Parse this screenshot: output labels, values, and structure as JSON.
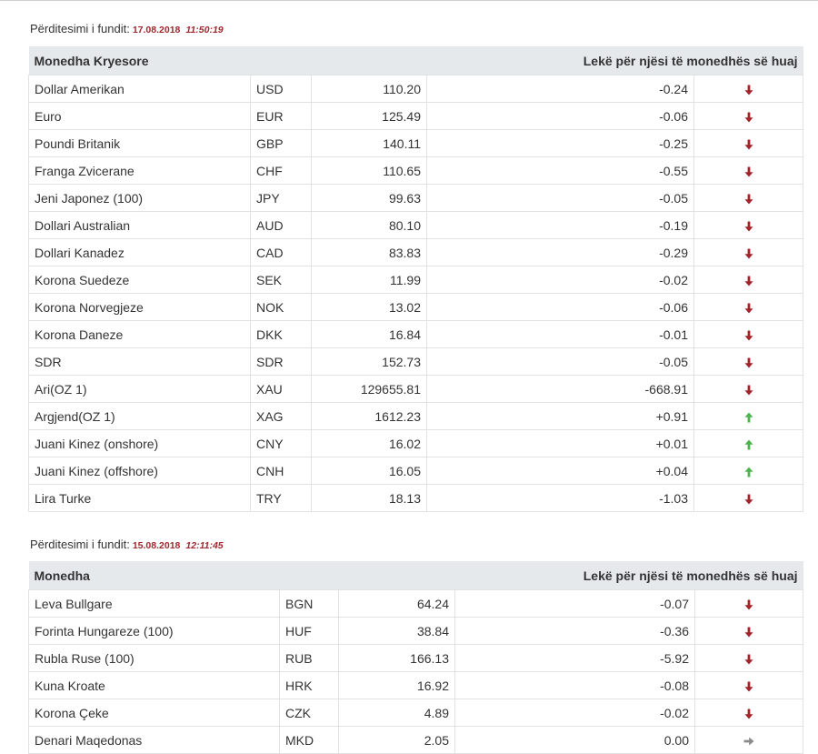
{
  "section1": {
    "update_label": "Përditesimi i fundit:",
    "date": "17.08.2018",
    "time": "11:50:19",
    "header_name": "Monedha Kryesore",
    "header_unit": "Lekë për njësi të monedhës së huaj",
    "rows": [
      {
        "name": "Dollar Amerikan",
        "code": "USD",
        "rate": "110.20",
        "change": "-0.24",
        "trend": "down"
      },
      {
        "name": "Euro",
        "code": "EUR",
        "rate": "125.49",
        "change": "-0.06",
        "trend": "down"
      },
      {
        "name": "Poundi Britanik",
        "code": "GBP",
        "rate": "140.11",
        "change": "-0.25",
        "trend": "down"
      },
      {
        "name": "Franga Zvicerane",
        "code": "CHF",
        "rate": "110.65",
        "change": "-0.55",
        "trend": "down"
      },
      {
        "name": "Jeni Japonez (100)",
        "code": "JPY",
        "rate": "99.63",
        "change": "-0.05",
        "trend": "down"
      },
      {
        "name": "Dollari Australian",
        "code": "AUD",
        "rate": "80.10",
        "change": "-0.19",
        "trend": "down"
      },
      {
        "name": "Dollari Kanadez",
        "code": "CAD",
        "rate": "83.83",
        "change": "-0.29",
        "trend": "down"
      },
      {
        "name": "Korona Suedeze",
        "code": "SEK",
        "rate": "11.99",
        "change": "-0.02",
        "trend": "down"
      },
      {
        "name": "Korona Norvegjeze",
        "code": "NOK",
        "rate": "13.02",
        "change": "-0.06",
        "trend": "down"
      },
      {
        "name": "Korona Daneze",
        "code": "DKK",
        "rate": "16.84",
        "change": "-0.01",
        "trend": "down"
      },
      {
        "name": "SDR",
        "code": "SDR",
        "rate": "152.73",
        "change": "-0.05",
        "trend": "down"
      },
      {
        "name": "Ari(OZ 1)",
        "code": "XAU",
        "rate": "129655.81",
        "change": "-668.91",
        "trend": "down"
      },
      {
        "name": "Argjend(OZ 1)",
        "code": "XAG",
        "rate": "1612.23",
        "change": "+0.91",
        "trend": "up"
      },
      {
        "name": "Juani Kinez (onshore)",
        "code": "CNY",
        "rate": "16.02",
        "change": "+0.01",
        "trend": "up"
      },
      {
        "name": "Juani Kinez (offshore)",
        "code": "CNH",
        "rate": "16.05",
        "change": "+0.04",
        "trend": "up"
      },
      {
        "name": "Lira Turke",
        "code": "TRY",
        "rate": "18.13",
        "change": "-1.03",
        "trend": "down"
      }
    ]
  },
  "section2": {
    "update_label": "Përditesimi i fundit:",
    "date": "15.08.2018",
    "time": "12:11:45",
    "header_name": "Monedha",
    "header_unit": "Lekë për njësi të monedhës së huaj",
    "rows": [
      {
        "name": "Leva Bullgare",
        "code": "BGN",
        "rate": "64.24",
        "change": "-0.07",
        "trend": "down"
      },
      {
        "name": "Forinta Hungareze (100)",
        "code": "HUF",
        "rate": "38.84",
        "change": "-0.36",
        "trend": "down"
      },
      {
        "name": "Rubla Ruse (100)",
        "code": "RUB",
        "rate": "166.13",
        "change": "-5.92",
        "trend": "down"
      },
      {
        "name": "Kuna Kroate",
        "code": "HRK",
        "rate": "16.92",
        "change": "-0.08",
        "trend": "down"
      },
      {
        "name": "Korona Çeke",
        "code": "CZK",
        "rate": "4.89",
        "change": "-0.02",
        "trend": "down"
      },
      {
        "name": "Denari Maqedonas",
        "code": "MKD",
        "rate": "2.05",
        "change": "0.00",
        "trend": "flat"
      }
    ]
  },
  "colors": {
    "down": "#a3232b",
    "up": "#4db34d",
    "flat": "#8a8a8a",
    "date_accent": "#a0282f",
    "header_bg": "#e6e9ec"
  },
  "icons": {
    "down": "arrow-down-icon",
    "up": "arrow-up-icon",
    "flat": "arrow-right-icon"
  }
}
